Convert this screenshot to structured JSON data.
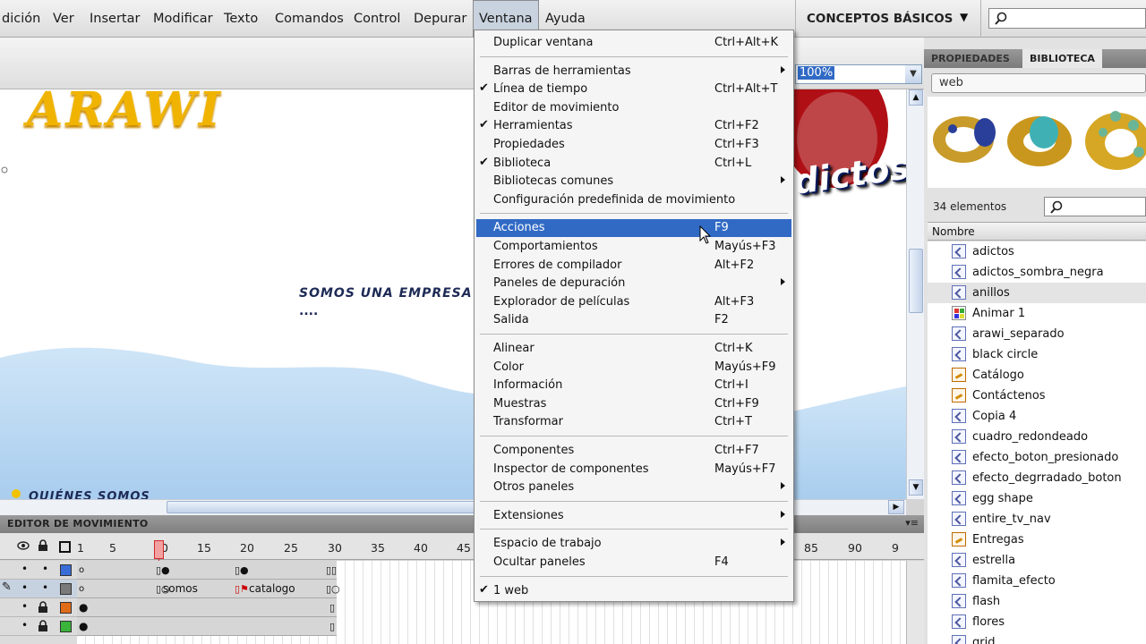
{
  "menubar": {
    "items": [
      "dición",
      "Ver",
      "Insertar",
      "Modificar",
      "Texto",
      "Comandos",
      "Control",
      "Depurar",
      "Ventana",
      "Ayuda"
    ],
    "workspace": "CONCEPTOS BÁSICOS"
  },
  "stage": {
    "zoom": "100%",
    "logo_text": "ARAWI",
    "body_text": "SOMOS UNA EMPRESA",
    "ellipsis": "....",
    "bottom_text": "QUIÉNES SOMOS",
    "graphic_text": "dictos"
  },
  "timeline": {
    "title": "EDITOR DE MOVIMIENTO",
    "ruler": [
      "1",
      "5",
      "10",
      "15",
      "20",
      "25",
      "30",
      "35",
      "40",
      "45",
      "85",
      "90",
      "9"
    ],
    "frame_labels": [
      "somos",
      "catalogo"
    ],
    "layer_colors": [
      "#3a6cd8",
      "#7a7a7a",
      "#e06c1a",
      "#3ab43a"
    ]
  },
  "library": {
    "tabs": [
      "PROPIEDADES",
      "BIBLIOTECA"
    ],
    "document": "web",
    "count": "34 elementos",
    "column": "Nombre",
    "items": [
      {
        "name": "adictos",
        "icon": "graphic-symbol-icon"
      },
      {
        "name": "adictos_sombra_negra",
        "icon": "graphic-symbol-icon"
      },
      {
        "name": "anillos",
        "icon": "graphic-symbol-icon"
      },
      {
        "name": "Animar 1",
        "icon": "motion-preset-icon"
      },
      {
        "name": "arawi_separado",
        "icon": "graphic-symbol-icon"
      },
      {
        "name": "black circle",
        "icon": "graphic-symbol-icon"
      },
      {
        "name": "Catálogo",
        "icon": "button-symbol-icon"
      },
      {
        "name": "Contáctenos",
        "icon": "button-symbol-icon"
      },
      {
        "name": "Copia 4",
        "icon": "graphic-symbol-icon"
      },
      {
        "name": "cuadro_redondeado",
        "icon": "graphic-symbol-icon"
      },
      {
        "name": "efecto_boton_presionado",
        "icon": "graphic-symbol-icon"
      },
      {
        "name": "efecto_degrradado_boton",
        "icon": "graphic-symbol-icon"
      },
      {
        "name": "egg shape",
        "icon": "graphic-symbol-icon"
      },
      {
        "name": "entire_tv_nav",
        "icon": "graphic-symbol-icon"
      },
      {
        "name": "Entregas",
        "icon": "button-symbol-icon"
      },
      {
        "name": "estrella",
        "icon": "graphic-symbol-icon"
      },
      {
        "name": "flamita_efecto",
        "icon": "graphic-symbol-icon"
      },
      {
        "name": "flash",
        "icon": "graphic-symbol-icon"
      },
      {
        "name": "flores",
        "icon": "graphic-symbol-icon"
      },
      {
        "name": "grid",
        "icon": "graphic-symbol-icon"
      }
    ]
  },
  "window_menu": {
    "groups": [
      [
        {
          "label": "Duplicar ventana",
          "shortcut": "Ctrl+Alt+K"
        }
      ],
      [
        {
          "label": "Barras de herramientas",
          "submenu": true
        },
        {
          "label": "Línea de tiempo",
          "shortcut": "Ctrl+Alt+T",
          "checked": true
        },
        {
          "label": "Editor de movimiento"
        },
        {
          "label": "Herramientas",
          "shortcut": "Ctrl+F2",
          "checked": true
        },
        {
          "label": "Propiedades",
          "shortcut": "Ctrl+F3"
        },
        {
          "label": "Biblioteca",
          "shortcut": "Ctrl+L",
          "checked": true
        },
        {
          "label": "Bibliotecas comunes",
          "submenu": true
        },
        {
          "label": "Configuración predefinida de movimiento"
        }
      ],
      [
        {
          "label": "Acciones",
          "shortcut": "F9",
          "highlighted": true
        },
        {
          "label": "Comportamientos",
          "shortcut": "Mayús+F3"
        },
        {
          "label": "Errores de compilador",
          "shortcut": "Alt+F2"
        },
        {
          "label": "Paneles de depuración",
          "submenu": true
        },
        {
          "label": "Explorador de películas",
          "shortcut": "Alt+F3"
        },
        {
          "label": "Salida",
          "shortcut": "F2"
        }
      ],
      [
        {
          "label": "Alinear",
          "shortcut": "Ctrl+K"
        },
        {
          "label": "Color",
          "shortcut": "Mayús+F9"
        },
        {
          "label": "Información",
          "shortcut": "Ctrl+I"
        },
        {
          "label": "Muestras",
          "shortcut": "Ctrl+F9"
        },
        {
          "label": "Transformar",
          "shortcut": "Ctrl+T"
        }
      ],
      [
        {
          "label": "Componentes",
          "shortcut": "Ctrl+F7"
        },
        {
          "label": "Inspector de componentes",
          "shortcut": "Mayús+F7"
        },
        {
          "label": "Otros paneles",
          "submenu": true
        }
      ],
      [
        {
          "label": "Extensiones",
          "submenu": true
        }
      ],
      [
        {
          "label": "Espacio de trabajo",
          "submenu": true
        },
        {
          "label": "Ocultar paneles",
          "shortcut": "F4"
        }
      ],
      [
        {
          "label": "1 web",
          "checked": true
        }
      ]
    ]
  }
}
